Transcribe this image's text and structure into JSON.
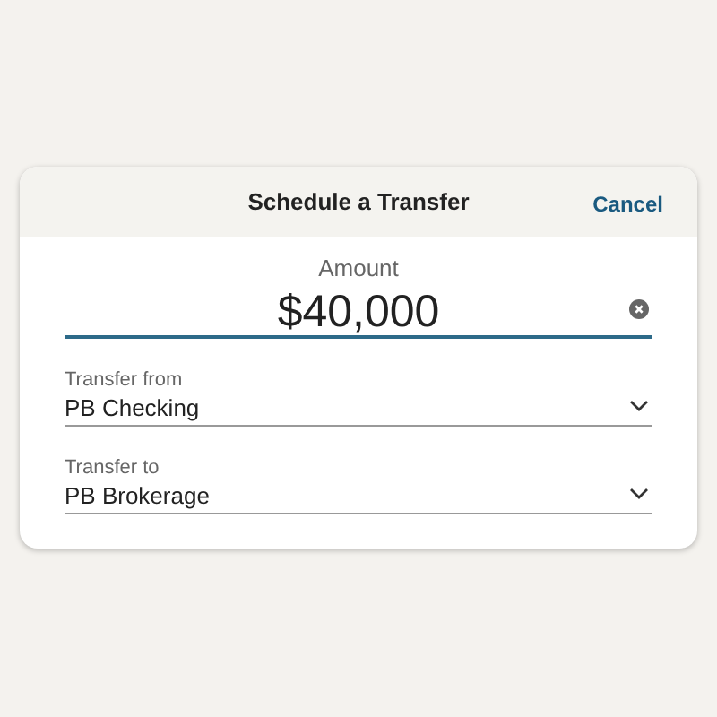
{
  "header": {
    "title": "Schedule a Transfer",
    "cancel": "Cancel"
  },
  "amount": {
    "label": "Amount",
    "value": "$40,000"
  },
  "selects": [
    {
      "label": "Transfer from",
      "value": "PB Checking"
    },
    {
      "label": "Transfer to",
      "value": "PB Brokerage"
    }
  ]
}
